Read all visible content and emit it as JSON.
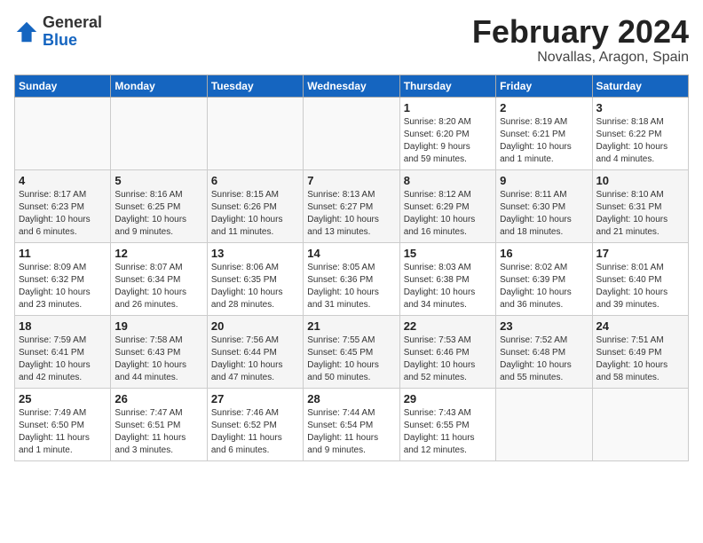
{
  "header": {
    "logo_general": "General",
    "logo_blue": "Blue",
    "month_title": "February 2024",
    "location": "Novallas, Aragon, Spain"
  },
  "weekdays": [
    "Sunday",
    "Monday",
    "Tuesday",
    "Wednesday",
    "Thursday",
    "Friday",
    "Saturday"
  ],
  "weeks": [
    [
      {
        "day": "",
        "info": ""
      },
      {
        "day": "",
        "info": ""
      },
      {
        "day": "",
        "info": ""
      },
      {
        "day": "",
        "info": ""
      },
      {
        "day": "1",
        "info": "Sunrise: 8:20 AM\nSunset: 6:20 PM\nDaylight: 9 hours\nand 59 minutes."
      },
      {
        "day": "2",
        "info": "Sunrise: 8:19 AM\nSunset: 6:21 PM\nDaylight: 10 hours\nand 1 minute."
      },
      {
        "day": "3",
        "info": "Sunrise: 8:18 AM\nSunset: 6:22 PM\nDaylight: 10 hours\nand 4 minutes."
      }
    ],
    [
      {
        "day": "4",
        "info": "Sunrise: 8:17 AM\nSunset: 6:23 PM\nDaylight: 10 hours\nand 6 minutes."
      },
      {
        "day": "5",
        "info": "Sunrise: 8:16 AM\nSunset: 6:25 PM\nDaylight: 10 hours\nand 9 minutes."
      },
      {
        "day": "6",
        "info": "Sunrise: 8:15 AM\nSunset: 6:26 PM\nDaylight: 10 hours\nand 11 minutes."
      },
      {
        "day": "7",
        "info": "Sunrise: 8:13 AM\nSunset: 6:27 PM\nDaylight: 10 hours\nand 13 minutes."
      },
      {
        "day": "8",
        "info": "Sunrise: 8:12 AM\nSunset: 6:29 PM\nDaylight: 10 hours\nand 16 minutes."
      },
      {
        "day": "9",
        "info": "Sunrise: 8:11 AM\nSunset: 6:30 PM\nDaylight: 10 hours\nand 18 minutes."
      },
      {
        "day": "10",
        "info": "Sunrise: 8:10 AM\nSunset: 6:31 PM\nDaylight: 10 hours\nand 21 minutes."
      }
    ],
    [
      {
        "day": "11",
        "info": "Sunrise: 8:09 AM\nSunset: 6:32 PM\nDaylight: 10 hours\nand 23 minutes."
      },
      {
        "day": "12",
        "info": "Sunrise: 8:07 AM\nSunset: 6:34 PM\nDaylight: 10 hours\nand 26 minutes."
      },
      {
        "day": "13",
        "info": "Sunrise: 8:06 AM\nSunset: 6:35 PM\nDaylight: 10 hours\nand 28 minutes."
      },
      {
        "day": "14",
        "info": "Sunrise: 8:05 AM\nSunset: 6:36 PM\nDaylight: 10 hours\nand 31 minutes."
      },
      {
        "day": "15",
        "info": "Sunrise: 8:03 AM\nSunset: 6:38 PM\nDaylight: 10 hours\nand 34 minutes."
      },
      {
        "day": "16",
        "info": "Sunrise: 8:02 AM\nSunset: 6:39 PM\nDaylight: 10 hours\nand 36 minutes."
      },
      {
        "day": "17",
        "info": "Sunrise: 8:01 AM\nSunset: 6:40 PM\nDaylight: 10 hours\nand 39 minutes."
      }
    ],
    [
      {
        "day": "18",
        "info": "Sunrise: 7:59 AM\nSunset: 6:41 PM\nDaylight: 10 hours\nand 42 minutes."
      },
      {
        "day": "19",
        "info": "Sunrise: 7:58 AM\nSunset: 6:43 PM\nDaylight: 10 hours\nand 44 minutes."
      },
      {
        "day": "20",
        "info": "Sunrise: 7:56 AM\nSunset: 6:44 PM\nDaylight: 10 hours\nand 47 minutes."
      },
      {
        "day": "21",
        "info": "Sunrise: 7:55 AM\nSunset: 6:45 PM\nDaylight: 10 hours\nand 50 minutes."
      },
      {
        "day": "22",
        "info": "Sunrise: 7:53 AM\nSunset: 6:46 PM\nDaylight: 10 hours\nand 52 minutes."
      },
      {
        "day": "23",
        "info": "Sunrise: 7:52 AM\nSunset: 6:48 PM\nDaylight: 10 hours\nand 55 minutes."
      },
      {
        "day": "24",
        "info": "Sunrise: 7:51 AM\nSunset: 6:49 PM\nDaylight: 10 hours\nand 58 minutes."
      }
    ],
    [
      {
        "day": "25",
        "info": "Sunrise: 7:49 AM\nSunset: 6:50 PM\nDaylight: 11 hours\nand 1 minute."
      },
      {
        "day": "26",
        "info": "Sunrise: 7:47 AM\nSunset: 6:51 PM\nDaylight: 11 hours\nand 3 minutes."
      },
      {
        "day": "27",
        "info": "Sunrise: 7:46 AM\nSunset: 6:52 PM\nDaylight: 11 hours\nand 6 minutes."
      },
      {
        "day": "28",
        "info": "Sunrise: 7:44 AM\nSunset: 6:54 PM\nDaylight: 11 hours\nand 9 minutes."
      },
      {
        "day": "29",
        "info": "Sunrise: 7:43 AM\nSunset: 6:55 PM\nDaylight: 11 hours\nand 12 minutes."
      },
      {
        "day": "",
        "info": ""
      },
      {
        "day": "",
        "info": ""
      }
    ]
  ]
}
